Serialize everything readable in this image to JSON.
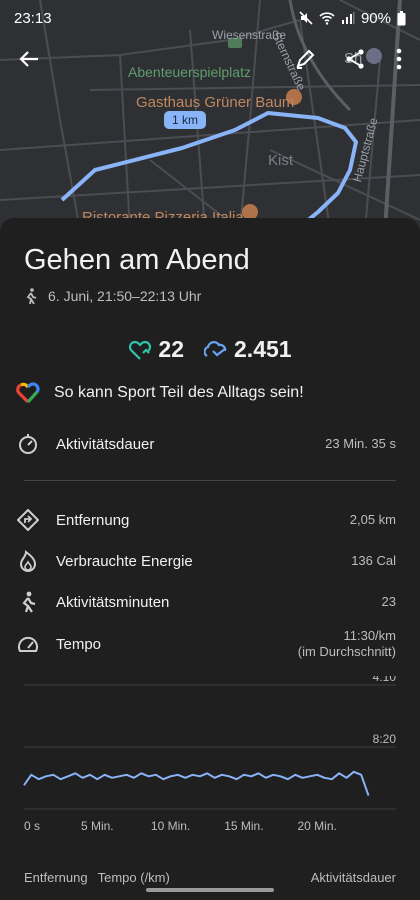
{
  "status": {
    "time": "23:13",
    "battery": "90%"
  },
  "map": {
    "labels": {
      "street1": "Wiesenstraße",
      "street2": "Sternstraße",
      "street3": "Hauptstraße",
      "park": "Abenteuerspielplatz",
      "restaurant1": "Gasthaus Grüner Baum",
      "district": "Kist",
      "restaurant2": "Ristorante Pizzeria Italia",
      "shop": "Sh"
    },
    "distance_marker": "1 km",
    "route_color": "#8ab4f8"
  },
  "activity": {
    "title": "Gehen am Abend",
    "date_time": "6. Juni, 21:50–22:13 Uhr",
    "heart_points": "22",
    "steps": "2.451",
    "promo_text": "So kann Sport Teil des Alltags sein!"
  },
  "metrics": [
    {
      "label": "Aktivitätsdauer",
      "value": "23 Min. 35 s",
      "icon": "timer-icon"
    },
    {
      "label": "Entfernung",
      "value": "2,05 km",
      "icon": "distance-icon"
    },
    {
      "label": "Verbrauchte Energie",
      "value": "136 Cal",
      "icon": "flame-icon"
    },
    {
      "label": "Aktivitätsminuten",
      "value": "23",
      "icon": "walk-icon"
    },
    {
      "label": "Tempo",
      "value": "11:30/km",
      "value_sub": "(im Durchschnitt)",
      "icon": "speedometer-icon"
    }
  ],
  "chart_data": {
    "type": "line",
    "x": [
      0,
      0.5,
      1,
      1.5,
      2,
      2.5,
      3,
      3.5,
      4,
      4.5,
      5,
      5.5,
      6,
      6.5,
      7,
      7.5,
      8,
      8.5,
      9,
      9.5,
      10,
      10.5,
      11,
      11.5,
      12,
      12.5,
      13,
      13.5,
      14,
      14.5,
      15,
      15.5,
      16,
      16.5,
      17,
      17.5,
      18,
      18.5,
      19,
      19.5,
      20,
      20.5,
      21,
      21.5,
      22,
      22.5,
      23,
      23.5
    ],
    "series": [
      {
        "values": [
          10.9,
          10.2,
          10.5,
          10.3,
          10.2,
          10.5,
          10.3,
          10.1,
          10.4,
          10.2,
          10.5,
          10.2,
          10.4,
          10.3,
          10.2,
          10.4,
          10.1,
          10.3,
          10.2,
          10.5,
          10.3,
          10.2,
          10.4,
          10.2,
          10.3,
          10.1,
          10.4,
          10.2,
          10.3,
          10.5,
          10.2,
          10.3,
          10.1,
          10.4,
          10.2,
          10.3,
          10.5,
          10.2,
          10.4,
          10.3,
          10.2,
          10.4,
          10.5,
          10.1,
          10.4,
          10.0,
          10.2,
          11.6
        ]
      }
    ],
    "y_ticks": [
      "4:10",
      "8:20"
    ],
    "x_ticks": [
      "0 s",
      "5 Min.",
      "10 Min.",
      "15 Min.",
      "20 Min."
    ],
    "xlim": [
      0,
      23.6
    ],
    "ylim_minutes_per_km": [
      4.1667,
      12.5
    ],
    "y_scale": "linear, inverted",
    "line_color": "#8ab4f8",
    "grid": true
  },
  "bottom_tabs": {
    "distance": "Entfernung",
    "pace": "Tempo (/km)",
    "activity": "Aktivitätsdauer"
  }
}
